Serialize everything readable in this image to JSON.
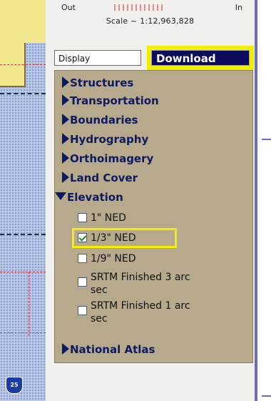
{
  "zoom": {
    "out_label": "Out",
    "in_label": "In"
  },
  "scale_text": "Scale ~ 1:12,963,828",
  "tabs": {
    "display_label": "Display",
    "download_label": "Download"
  },
  "categories": [
    {
      "label": "Structures"
    },
    {
      "label": "Transportation"
    },
    {
      "label": "Boundaries"
    },
    {
      "label": "Hydrography"
    },
    {
      "label": "Orthoimagery"
    },
    {
      "label": "Land Cover"
    },
    {
      "label": "Elevation",
      "expanded": true
    },
    {
      "label": "National Atlas"
    }
  ],
  "elevation_items": [
    {
      "label": "1\" NED",
      "checked": false
    },
    {
      "label": "1/3\" NED",
      "checked": true
    },
    {
      "label": "1/9\" NED",
      "checked": false
    },
    {
      "label": "SRTM Finished 3 arc",
      "label2": "sec",
      "checked": false
    },
    {
      "label": "SRTM Finished 1 arc",
      "label2": "sec",
      "checked": false
    }
  ],
  "map": {
    "shield_label": "25"
  },
  "colors": {
    "download_tab_bg": "#0c0c5e",
    "highlight": "#f2ee00",
    "layer_panel_bg": "#b7a98b",
    "category_text": "#0d1a63"
  }
}
